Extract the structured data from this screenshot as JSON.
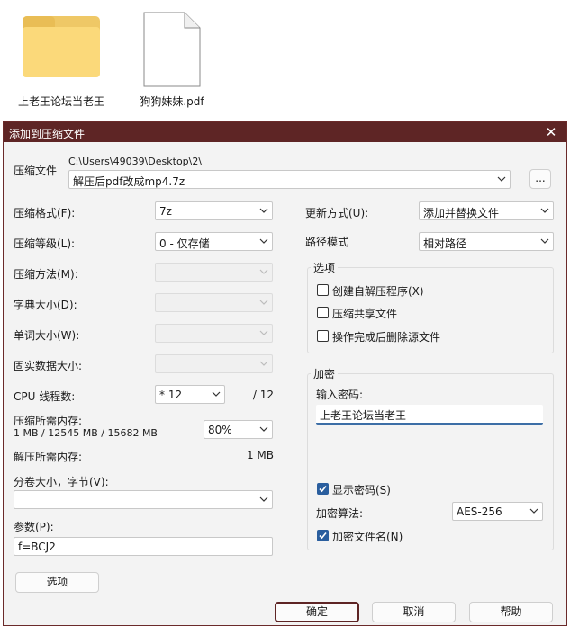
{
  "desktop": {
    "items": [
      {
        "label": "上老王论坛当老王",
        "icon": "folder-icon"
      },
      {
        "label": "狗狗妹妹.pdf",
        "icon": "pdf-file-icon"
      }
    ]
  },
  "dialog": {
    "title": "添加到压缩文件",
    "archive": {
      "label": "压缩文件",
      "path": "C:\\Users\\49039\\Desktop\\2\\",
      "name": "解压后pdf改成mp4.7z",
      "browse_label": "..."
    },
    "left": {
      "format": {
        "label": "压缩格式(F):",
        "value": "7z"
      },
      "level": {
        "label": "压缩等级(L):",
        "value": "0 - 仅存储"
      },
      "method": {
        "label": "压缩方法(M):",
        "value": ""
      },
      "dict": {
        "label": "字典大小(D):",
        "value": ""
      },
      "word": {
        "label": "单词大小(W):",
        "value": ""
      },
      "solid": {
        "label": "固实数据大小:",
        "value": ""
      },
      "threads": {
        "label": "CPU 线程数:",
        "value": "* 12",
        "max": "/ 12"
      },
      "memory": {
        "label": "压缩所需内存:",
        "detail": "1 MB / 12545 MB / 15682 MB",
        "percent": "80%"
      },
      "decomp": {
        "label": "解压所需内存:",
        "value": "1 MB"
      },
      "volume": {
        "label": "分卷大小，字节(V):",
        "value": ""
      },
      "params": {
        "label": "参数(P):",
        "value": "f=BCJ2"
      },
      "options_button": "选项"
    },
    "right": {
      "update": {
        "label": "更新方式(U):",
        "value": "添加并替换文件"
      },
      "pathmode": {
        "label": "路径模式",
        "value": "相对路径"
      },
      "options_group": {
        "title": "选项",
        "sfx": {
          "label": "创建自解压程序(X)",
          "checked": false
        },
        "shared": {
          "label": "压缩共享文件",
          "checked": false
        },
        "delete": {
          "label": "操作完成后删除源文件",
          "checked": false
        }
      },
      "encryption": {
        "title": "加密",
        "password_label": "输入密码:",
        "password": "上老王论坛当老王",
        "show_password": {
          "label": "显示密码(S)",
          "checked": true
        },
        "method_label": "加密算法:",
        "method": "AES-256",
        "encrypt_names": {
          "label": "加密文件名(N)",
          "checked": true
        }
      }
    },
    "buttons": {
      "ok": "确定",
      "cancel": "取消",
      "help": "帮助"
    },
    "colors": {
      "titlebar": "#5e2525",
      "checkbox_on": "#2a5e9e",
      "password_underline": "#3c6ea6"
    }
  }
}
